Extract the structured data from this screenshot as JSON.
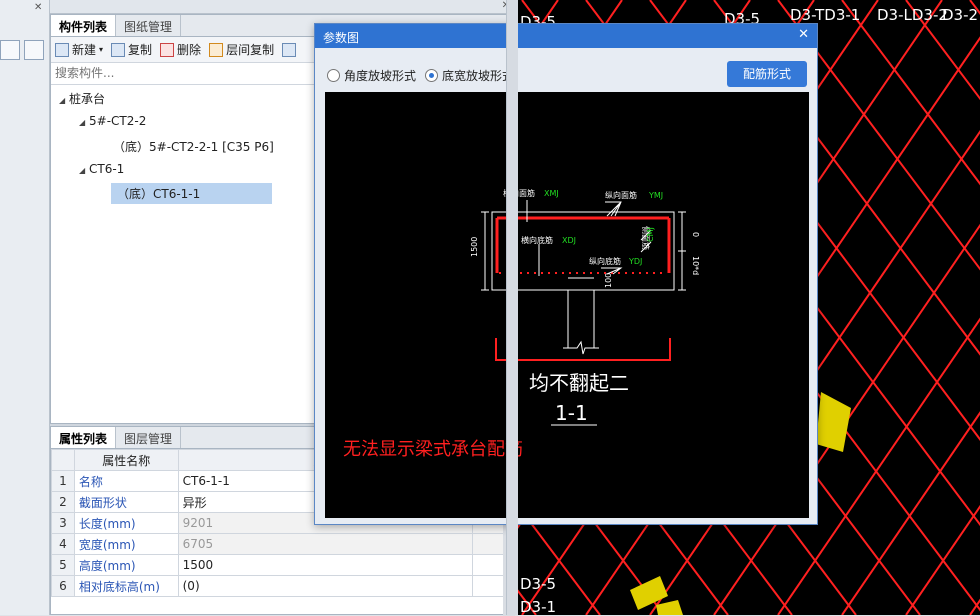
{
  "left_panel": {
    "tabs": [
      "构件列表",
      "图纸管理"
    ],
    "toolbar": {
      "new": "新建",
      "copy": "复制",
      "delete": "删除",
      "floor_copy": "层间复制"
    },
    "search_placeholder": "搜索构件...",
    "tree": {
      "root": "桩承台",
      "group1": "5#-CT2-2",
      "group1_child": "（底）5#-CT2-2-1 [C35 P6]",
      "group2": "CT6-1",
      "group2_child": "（底）CT6-1-1"
    }
  },
  "props_panel": {
    "tabs": [
      "属性列表",
      "图层管理"
    ],
    "header_name": "属性名称",
    "header_value": "属性",
    "rows": [
      {
        "num": "1",
        "name": "名称",
        "value": "CT6-1-1"
      },
      {
        "num": "2",
        "name": "截面形状",
        "value": "异形"
      },
      {
        "num": "3",
        "name": "长度(mm)",
        "value": "9201"
      },
      {
        "num": "4",
        "name": "宽度(mm)",
        "value": "6705"
      },
      {
        "num": "5",
        "name": "高度(mm)",
        "value": "1500"
      },
      {
        "num": "6",
        "name": "相对底标高(m)",
        "value": "(0)"
      }
    ]
  },
  "dialog": {
    "title": "参数图",
    "close": "✕",
    "radio1": "角度放坡形式",
    "radio2": "底宽放坡形式",
    "selected": "底宽放坡形式",
    "button": "配筋形式",
    "diagram": {
      "label_top_trans": "横向面筋",
      "label_top_trans_code": "XMJ",
      "label_top_long": "纵向面筋",
      "label_top_long_code": "YMJ",
      "label_bot_trans": "横向底筋",
      "label_bot_trans_code": "XDJ",
      "label_bot_long": "纵向底筋",
      "label_bot_long_code": "YDJ",
      "label_side": "侧面筋",
      "label_side_code": "CMJ",
      "dim_height": "1500",
      "dim_right_top": "0",
      "dim_right_bottom": "10*d",
      "dim_pile": "100",
      "note": "均不翻起二",
      "section": "1-1",
      "warning": "无法显示梁式承台配筋"
    }
  },
  "cad": {
    "labels": [
      "D3-5",
      "D3-5",
      "D3-TD3-1",
      "D3-LD3-2",
      "D3-2",
      "D3-5",
      "D3-1"
    ],
    "grid_color": "#ff2020",
    "text_color": "#ffffff",
    "highlight_color": "#e0d000"
  }
}
